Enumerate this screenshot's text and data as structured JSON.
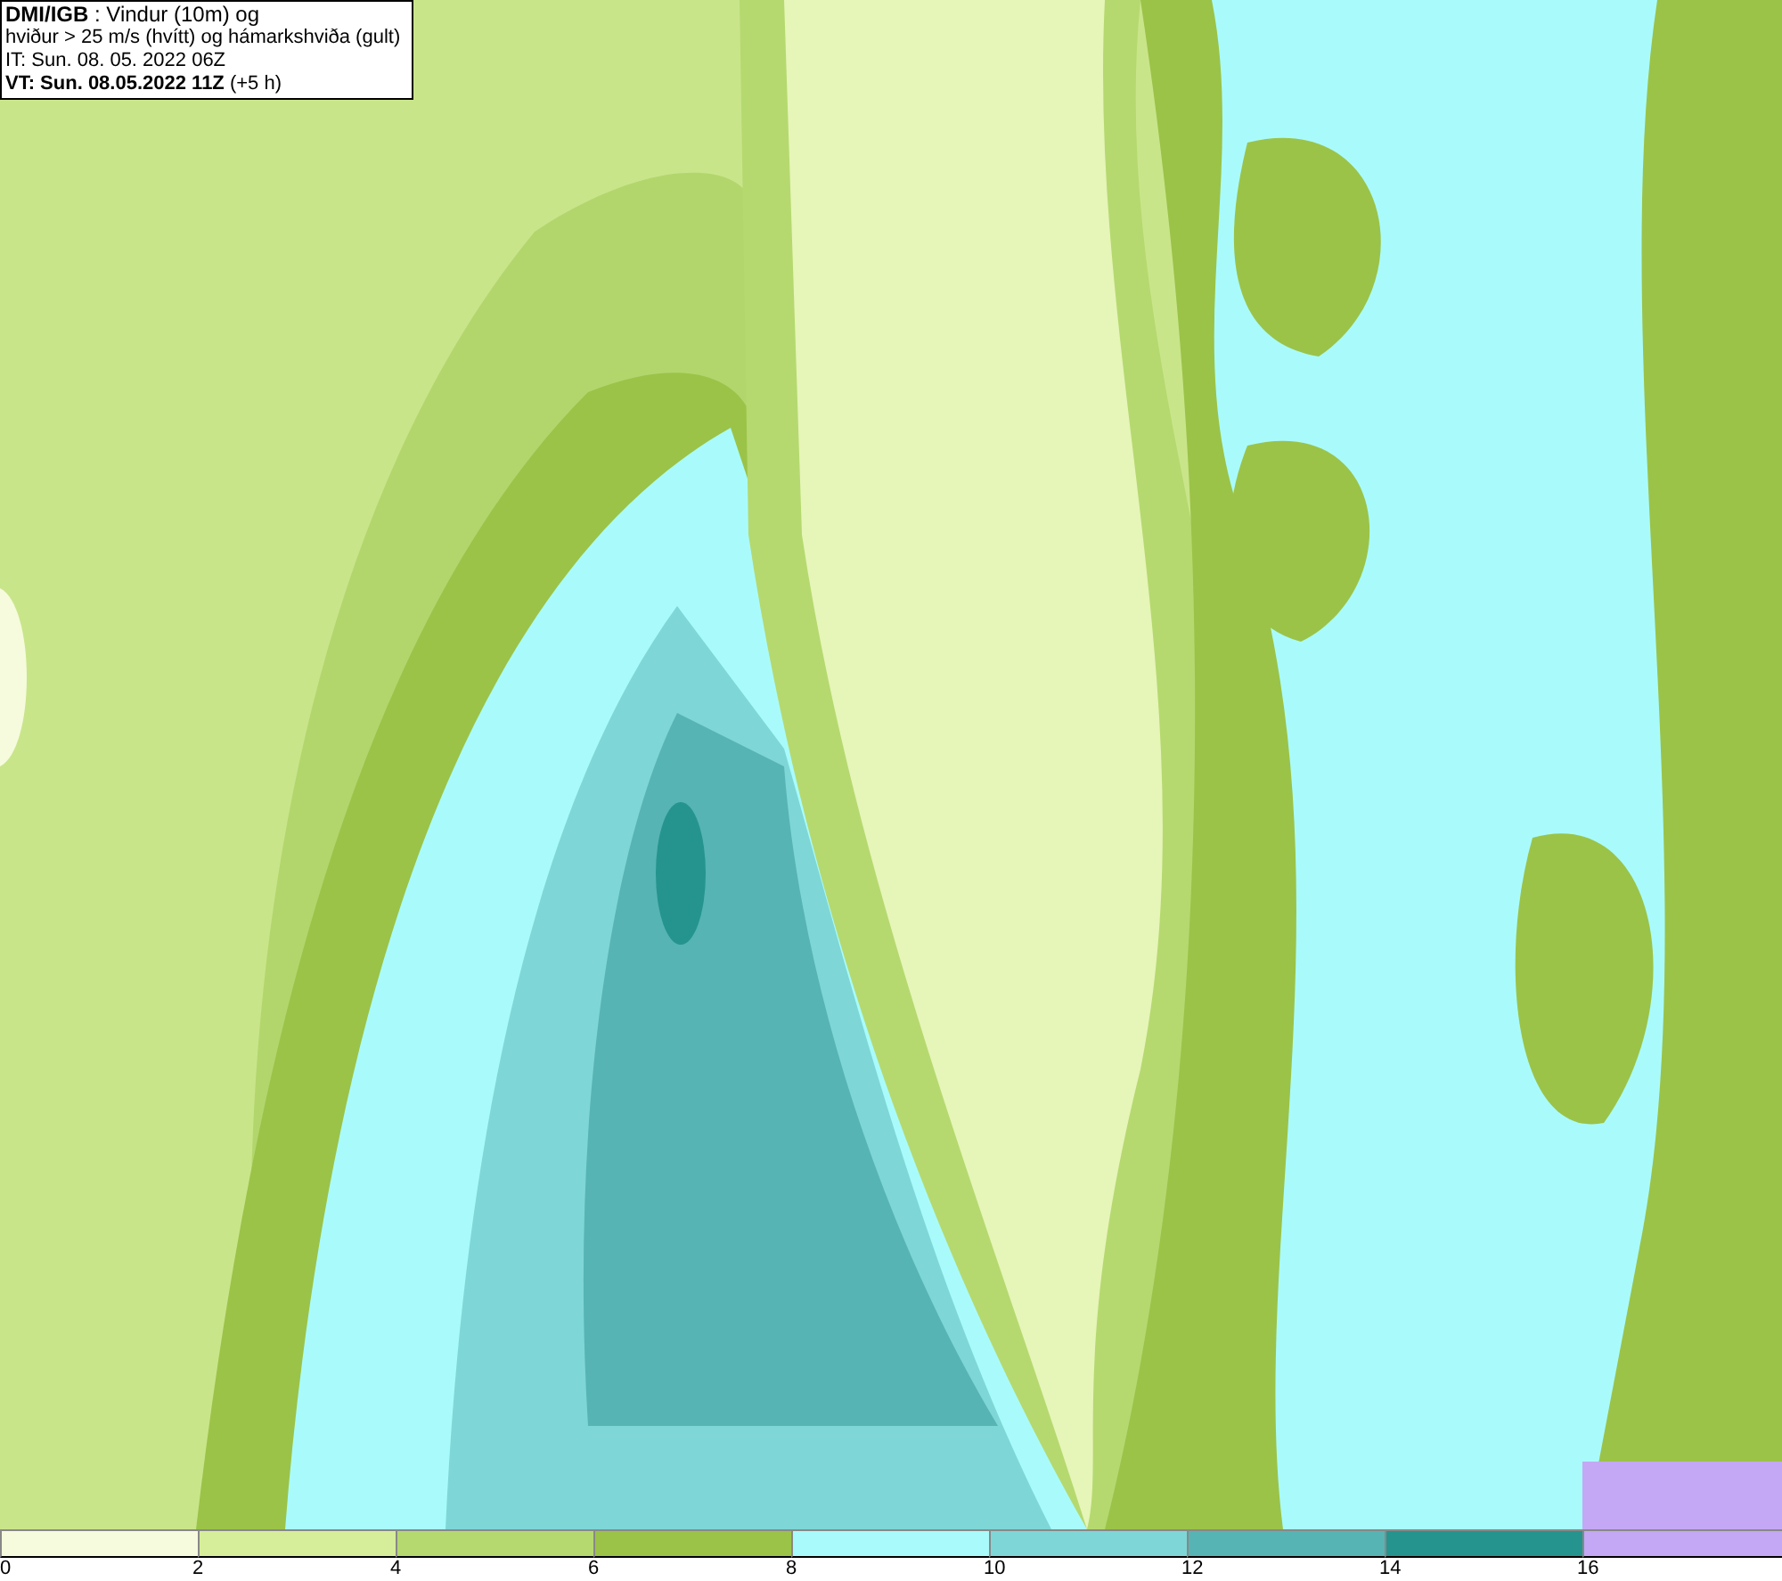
{
  "header": {
    "lines": [
      "**DMI/IGB** : Vindur (10m) og",
      "hviður > 25 m/s (hvítt) og hámarkshviða (gult)",
      "IT: Sun. 08. 05. 2022 06Z",
      "**VT: Sun. 08.05.2022 11Z** (+5 h)"
    ]
  },
  "legend": [
    {
      "label": "0",
      "color": "#f5fbdc"
    },
    {
      "label": "2",
      "color": "#d6ee9a"
    },
    {
      "label": "4",
      "color": "#b5d96f"
    },
    {
      "label": "6",
      "color": "#9bc348"
    },
    {
      "label": "8",
      "color": "#a9fbfb"
    },
    {
      "label": "10",
      "color": "#7fd6d6"
    },
    {
      "label": "12",
      "color": "#56b4b4"
    },
    {
      "label": "14",
      "color": "#25948f"
    },
    {
      "label": "16",
      "color": "#c4a8f5"
    }
  ]
}
